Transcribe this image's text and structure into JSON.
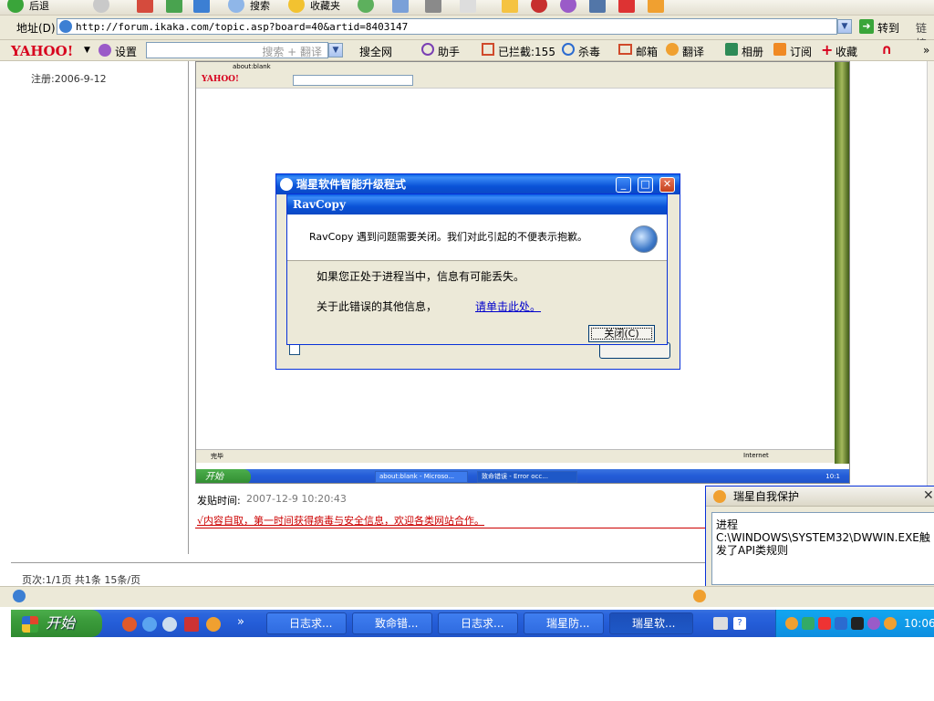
{
  "toolbar": {
    "back_label": "后退",
    "search_label": "搜索",
    "favorites_label": "收藏夹"
  },
  "address": {
    "label": "地址(D)",
    "url": "http://forum.ikaka.com/topic.asp?board=40&artid=8403147",
    "go_label": "转到",
    "links_label": "链接"
  },
  "yahoo": {
    "logo": "YAHOO!",
    "settings": "设置",
    "search_placeholder": "搜索 + 翻译",
    "search_web": "搜全网",
    "assistant": "助手",
    "blocked": "已拦截:155",
    "antivirus": "杀毒",
    "mail": "邮箱",
    "translate": "翻译",
    "album": "相册",
    "rss": "订阅",
    "favorites": "收藏",
    "more": "»"
  },
  "page": {
    "register_date": "注册:2006-9-12",
    "post_time_label": "发贴时间:",
    "post_time": "2007-12-9 10:20:43",
    "banner_link": "√内容自取，第一时间获得病毒与安全信息，欢迎各类网站合作。",
    "pagination": "页次:1/1页 共1条 15条/页"
  },
  "inner_screenshot": {
    "address_snippet": "about:blank",
    "yahoo_logo": "YAHOO!",
    "status_done": "完毕",
    "status_zone": "Internet",
    "start_label": "开始",
    "task1": "about:blank - Microso...",
    "task2": "致命错误 - Error occ...",
    "clock": "10:1"
  },
  "updater_dialog": {
    "title": "瑞星软件智能升级程式"
  },
  "error_dialog": {
    "title": "RavCopy",
    "message": "RavCopy 遇到问题需要关闭。我们对此引起的不便表示抱歉。",
    "info_line": "如果您正处于进程当中，信息有可能丢失。",
    "more_info_label": "关于此错误的其他信息，",
    "more_info_link": "请单击此处。",
    "close_button": "关闭(C)"
  },
  "protect_popup": {
    "title": "瑞星自我保护",
    "message": "进程C:\\WINDOWS\\SYSTEM32\\DWWIN.EXE触发了API类规则"
  },
  "taskbar": {
    "start_label": "开始",
    "more": "»",
    "tasks": [
      "日志求...",
      "致命错...",
      "日志求...",
      "瑞星防...",
      "瑞星软..."
    ],
    "clock": "10:06"
  },
  "colors": {
    "xp_blue": "#0a52d7",
    "start_green": "#3b9b3b",
    "tray_blue": "#0d8ee0",
    "yahoo_red": "#d7001d",
    "banner_red": "#cc0000"
  }
}
